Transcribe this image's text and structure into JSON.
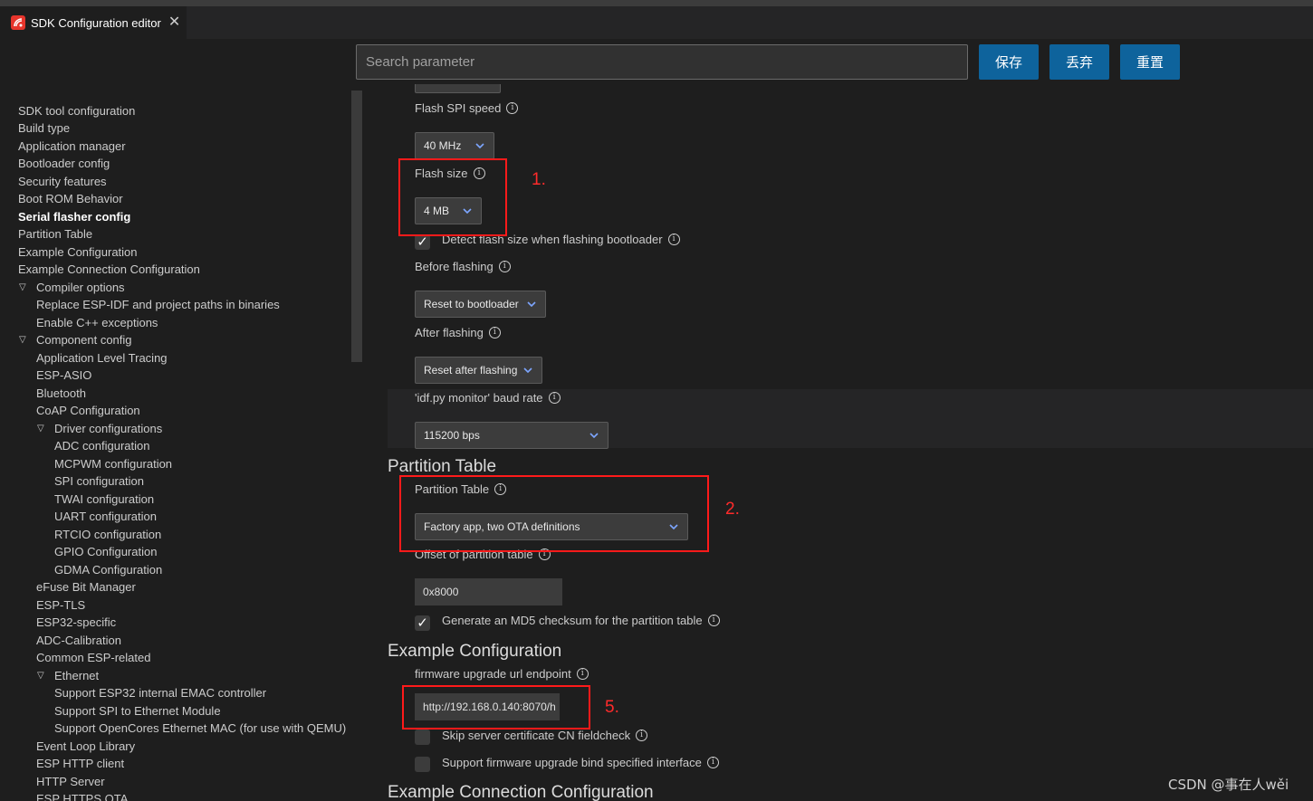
{
  "tab": {
    "title": "SDK Configuration editor",
    "close": "✕"
  },
  "search": {
    "placeholder": "Search parameter"
  },
  "buttons": {
    "save": "保存",
    "discard": "丢弃",
    "reset": "重置"
  },
  "sidebar": {
    "items": [
      "SDK tool configuration",
      "Build type",
      "Application manager",
      "Bootloader config",
      "Security features",
      "Boot ROM Behavior",
      "Serial flasher config",
      "Partition Table",
      "Example Configuration",
      "Example Connection Configuration",
      "Compiler options",
      "Replace ESP-IDF and project paths in binaries",
      "Enable C++ exceptions",
      "Component config",
      "Application Level Tracing",
      "ESP-ASIO",
      "Bluetooth",
      "CoAP Configuration",
      "Driver configurations",
      "ADC configuration",
      "MCPWM configuration",
      "SPI configuration",
      "TWAI configuration",
      "UART configuration",
      "RTCIO configuration",
      "GPIO Configuration",
      "GDMA Configuration",
      "eFuse Bit Manager",
      "ESP-TLS",
      "ESP32-specific",
      "ADC-Calibration",
      "Common ESP-related",
      "Ethernet",
      "Support ESP32 internal EMAC controller",
      "Support SPI to Ethernet Module",
      "Support OpenCores Ethernet MAC (for use with QEMU)",
      "Event Loop Library",
      "ESP HTTP client",
      "HTTP Server",
      "ESP HTTPS OTA"
    ]
  },
  "main": {
    "flash_spi_speed": {
      "label": "Flash SPI speed",
      "value": "40 MHz"
    },
    "flash_size": {
      "label": "Flash size",
      "value": "4 MB"
    },
    "detect_flash": {
      "label": "Detect flash size when flashing bootloader",
      "checked": true
    },
    "before_flashing": {
      "label": "Before flashing",
      "value": "Reset to bootloader"
    },
    "after_flashing": {
      "label": "After flashing",
      "value": "Reset after flashing"
    },
    "monitor_baud": {
      "label": "'idf.py monitor' baud rate",
      "value": "115200 bps"
    },
    "partition_section": "Partition Table",
    "partition_table": {
      "label": "Partition Table",
      "value": "Factory app, two OTA definitions"
    },
    "partition_offset": {
      "label": "Offset of partition table",
      "value": "0x8000"
    },
    "md5_checksum": {
      "label": "Generate an MD5 checksum for the partition table",
      "checked": true
    },
    "example_section": "Example Configuration",
    "firmware_url": {
      "label": "firmware upgrade url endpoint",
      "value": "http://192.168.0.140:8070/h"
    },
    "skip_cn": {
      "label": "Skip server certificate CN fieldcheck",
      "checked": false
    },
    "bind_iface": {
      "label": "Support firmware upgrade bind specified interface",
      "checked": false
    },
    "connection_section": "Example Connection Configuration"
  },
  "annotations": {
    "a1": "1.",
    "a2": "2.",
    "a5": "5."
  },
  "watermark": "CSDN @事在人wěi",
  "colors": {
    "accent_button": "#0e639c",
    "annotation_red": "#ff1a1a",
    "background": "#1e1e1e"
  },
  "info_icon": "i"
}
